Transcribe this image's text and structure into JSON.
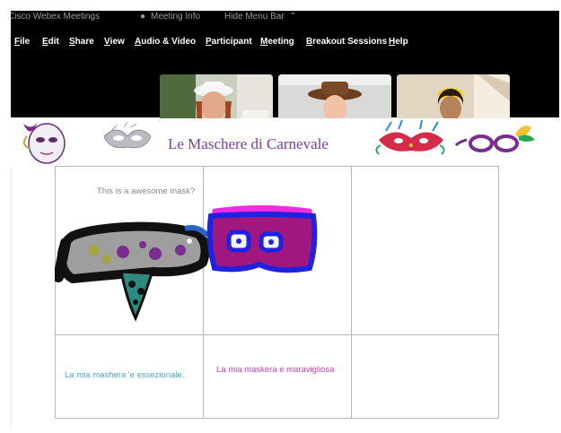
{
  "window": {
    "app_title": "Cisco Webex Meetings",
    "meeting_info": "Meeting Info",
    "hide_menu": "Hide Menu Bar"
  },
  "menu": [
    {
      "key": "F",
      "rest": "ile"
    },
    {
      "key": "E",
      "rest": "dit"
    },
    {
      "key": "S",
      "rest": "hare"
    },
    {
      "key": "V",
      "rest": "iew"
    },
    {
      "key": "A",
      "rest": "udio & Video"
    },
    {
      "key": "P",
      "rest": "articipant"
    },
    {
      "key": "M",
      "rest": "eeting"
    },
    {
      "key": "B",
      "rest": "reakout Sessions"
    },
    {
      "key": "H",
      "rest": "elp"
    }
  ],
  "banner": {
    "title": "Le Maschere di Carnevale"
  },
  "board": {
    "cell_1_text": "This is a awesome mask?",
    "cell_4_text": "La mia mashera 'e essezionale.",
    "cell_5_text": "La mia maskera e maravigliosa"
  },
  "colors": {
    "title_purple": "#7c3aa8",
    "text_gray": "#8a8a8a",
    "text_teal": "#4aa6c9",
    "text_magenta": "#c03fb4"
  }
}
